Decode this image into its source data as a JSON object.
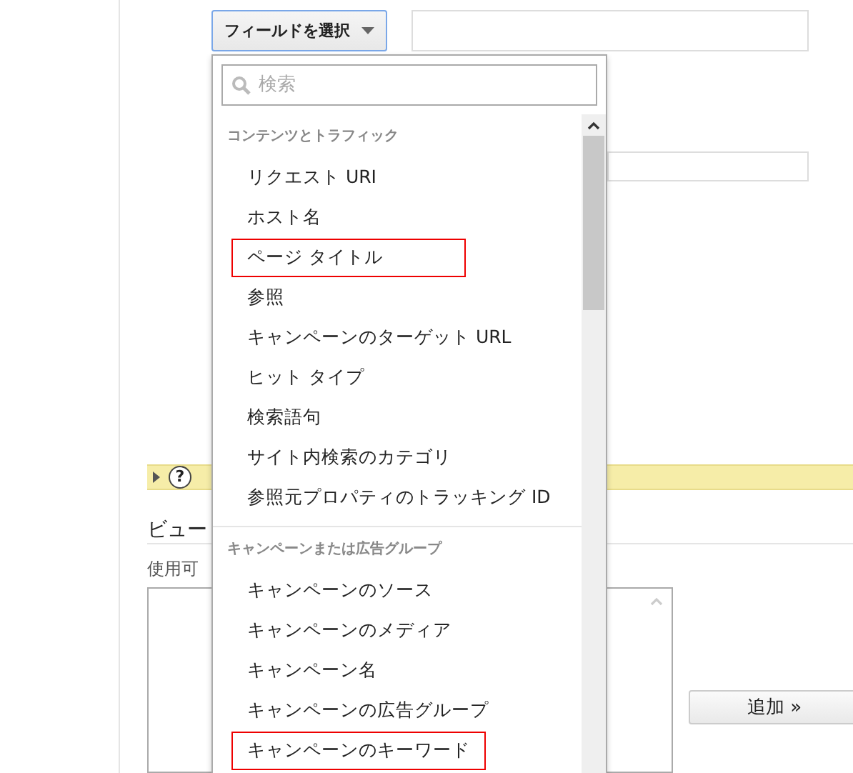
{
  "field_select": {
    "label": "フィールドを選択"
  },
  "info_bar": {
    "help_glyph": "?"
  },
  "section_title": "ビュー",
  "available_label": "使用可",
  "add_button": "追加 »",
  "dropdown": {
    "search": {
      "placeholder": "検索"
    },
    "groups": [
      {
        "heading": "コンテンツとトラフィック",
        "items": [
          {
            "label": "リクエスト URI",
            "highlighted": false
          },
          {
            "label": "ホスト名",
            "highlighted": false
          },
          {
            "label": "ページ タイトル",
            "highlighted": true
          },
          {
            "label": "参照",
            "highlighted": false
          },
          {
            "label": "キャンペーンのターゲット URL",
            "highlighted": false
          },
          {
            "label": "ヒット タイプ",
            "highlighted": false
          },
          {
            "label": "検索語句",
            "highlighted": false
          },
          {
            "label": "サイト内検索のカテゴリ",
            "highlighted": false
          },
          {
            "label": "参照元プロパティのトラッキング ID",
            "highlighted": false
          }
        ]
      },
      {
        "heading": "キャンペーンまたは広告グループ",
        "items": [
          {
            "label": "キャンペーンのソース",
            "highlighted": false
          },
          {
            "label": "キャンペーンのメディア",
            "highlighted": false
          },
          {
            "label": "キャンペーン名",
            "highlighted": false
          },
          {
            "label": "キャンペーンの広告グループ",
            "highlighted": false
          },
          {
            "label": "キャンペーンのキーワード",
            "highlighted": true
          }
        ]
      }
    ]
  }
}
